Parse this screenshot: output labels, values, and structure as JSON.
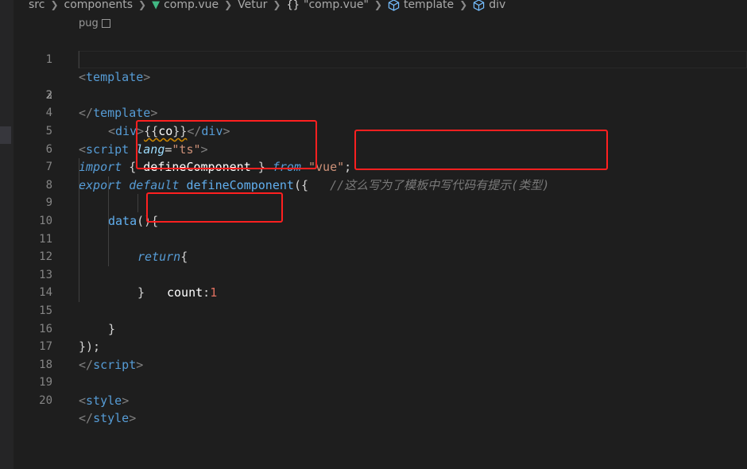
{
  "breadcrumb": {
    "items": [
      "src",
      "components",
      "comp.vue",
      "Vetur",
      "\"comp.vue\"",
      "template",
      "div"
    ]
  },
  "lens": {
    "label": "pug"
  },
  "editor": {
    "line_numbers": [
      "1",
      "2",
      "3",
      "4",
      "5",
      "6",
      "7",
      "8",
      "9",
      "10",
      "11",
      "12",
      "13",
      "14",
      "15",
      "16",
      "17",
      "18",
      "19",
      "20"
    ],
    "current_line": 2,
    "lines": {
      "l1": {
        "open": "<",
        "tag": "template",
        "close": ">"
      },
      "l2": {
        "open": "<",
        "tag": "div",
        "close": ">",
        "mustache_open": "{{",
        "expr": "co",
        "mustache_close": "}}",
        "end_open": "</",
        "end_tag": "div",
        "end_close": ">"
      },
      "l3": {
        "open": "</",
        "tag": "template",
        "close": ">"
      },
      "l5": {
        "open": "<",
        "tag": "script",
        "attr": "lang",
        "eq": "=",
        "value": "\"ts\"",
        "close": ">"
      },
      "l6": {
        "kw_import": "import",
        "brace_open": "{",
        "name": "defineComponent",
        "brace_close": "}",
        "kw_from": "from",
        "module": "\"vue\"",
        "semi": ";"
      },
      "l7": {
        "kw_export": "export",
        "kw_default": "default",
        "fn": "defineComponent",
        "paren": "({",
        "comment": "//这么写为了模板中写代码有提示(类型)"
      },
      "l8": {
        "fn": "data",
        "rest": "(){"
      },
      "l9": {
        "kw_return": "return",
        "brace": "{"
      },
      "l10": {
        "prop": "count",
        "colon": ":",
        "num": "1"
      },
      "l11": {
        "brace": "}"
      },
      "l14": {
        "brace": "}"
      },
      "l16": {
        "text": "});"
      },
      "l17": {
        "open": "</",
        "tag": "script",
        "close": ">"
      },
      "l19": {
        "open": "<",
        "tag": "style",
        "close": ">"
      },
      "l20": {
        "open": "</",
        "tag": "style",
        "close": ">"
      }
    }
  },
  "colors": {
    "background": "#1e1e1e",
    "annotation": "#ff2020",
    "tag": "#569cd6",
    "string": "#ce9178",
    "function": "#dcdcaa"
  }
}
